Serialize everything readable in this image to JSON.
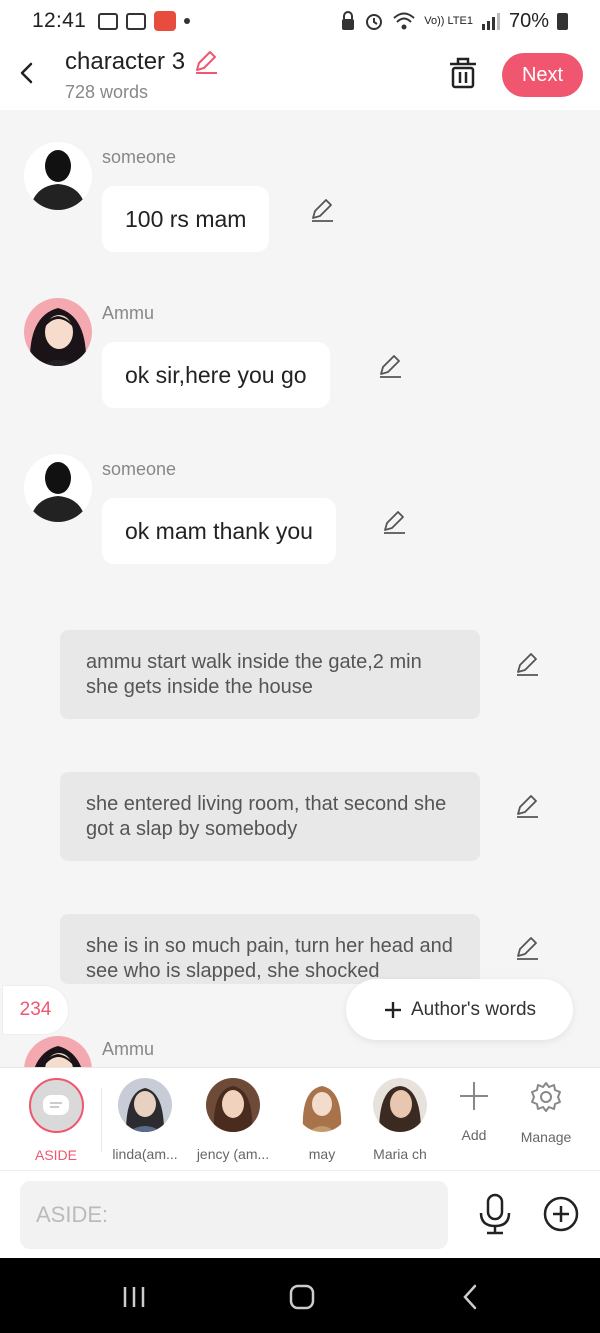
{
  "status_bar": {
    "time": "12:41",
    "network": "Vo)) LTE1",
    "battery": "70%"
  },
  "header": {
    "title": "character 3",
    "subtitle": "728 words",
    "next_label": "Next"
  },
  "messages": [
    {
      "speaker": "someone",
      "text": "100 rs mam",
      "avatar": "silhouette-avatar"
    },
    {
      "speaker": "Ammu",
      "text": "ok sir,here you go",
      "avatar": "ammu-avatar"
    },
    {
      "speaker": "someone",
      "text": "ok mam thank you",
      "avatar": "silhouette-avatar"
    }
  ],
  "asides": [
    {
      "text": "ammu start walk inside the gate,2 min she gets inside the house"
    },
    {
      "text": "she entered living room, that second she got a slap by somebody"
    },
    {
      "text": "she is in so much pain, turn her head and see who is slapped, she shocked"
    }
  ],
  "partial_message": {
    "speaker": "Ammu"
  },
  "count_badge": "234",
  "author_words_label": "Author's words",
  "characters": [
    {
      "label": "ASIDE",
      "active": true
    },
    {
      "label": "linda(am..."
    },
    {
      "label": "jency (am..."
    },
    {
      "label": "may"
    },
    {
      "label": "Maria ch"
    }
  ],
  "tools": {
    "add_label": "Add",
    "manage_label": "Manage"
  },
  "input": {
    "placeholder": "ASIDE:"
  },
  "colors": {
    "accent": "#f0566f",
    "background": "#f5f5f5",
    "aside_bg": "#e8e8e8"
  }
}
